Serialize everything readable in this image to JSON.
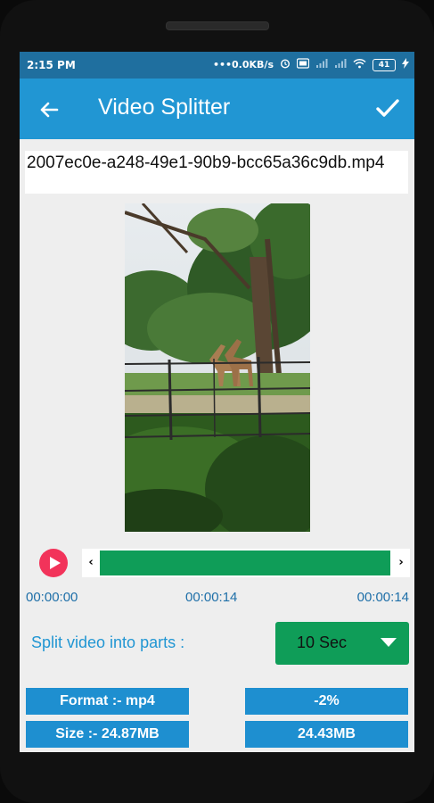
{
  "status_bar": {
    "time": "2:15 PM",
    "network_speed": "0.0KB/s",
    "battery_level": "41"
  },
  "toolbar": {
    "title": "Video Splitter"
  },
  "file": {
    "name": "2007ec0e-a248-49e1-90b9-bcc65a36c9db.mp4"
  },
  "player": {
    "start_time": "00:00:00",
    "current_time": "00:00:14",
    "end_time": "00:00:14",
    "selected_fraction": 1.0
  },
  "split": {
    "label": "Split video into parts :",
    "selected": "10 Sec"
  },
  "info": {
    "format": "Format :- mp4",
    "percent": "-2%",
    "size": "Size :- 24.87MB",
    "output_size": "24.43MB"
  },
  "colors": {
    "toolbar": "#2196d3",
    "status_bar": "#1f6f9f",
    "accent_green": "#0f9d58",
    "play_button": "#f2335a",
    "info_box": "#1e8fd0"
  },
  "icons": {
    "back": "arrow-left-icon",
    "confirm": "check-icon",
    "play": "play-icon",
    "dropdown": "caret-down-icon"
  }
}
